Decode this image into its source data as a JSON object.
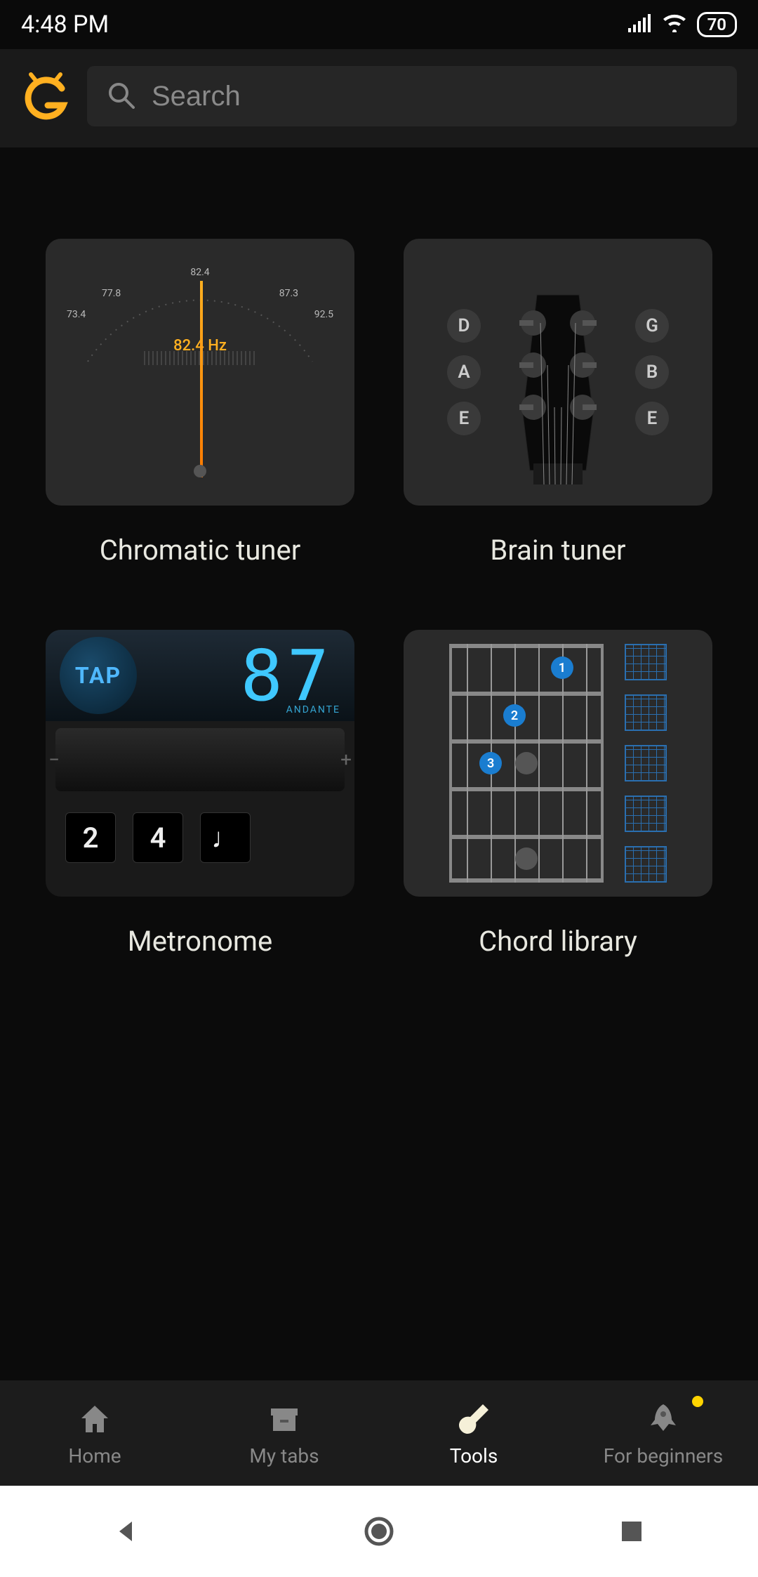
{
  "status": {
    "time": "4:48 PM",
    "battery": "70"
  },
  "search": {
    "placeholder": "Search"
  },
  "tools": {
    "chromatic": {
      "label": "Chromatic tuner",
      "frequency": "82.4 Hz",
      "ticks": {
        "t1": "73.4",
        "t2": "77.8",
        "t3": "82.4",
        "t4": "87.3",
        "t5": "92.5"
      }
    },
    "brain": {
      "label": "Brain tuner",
      "left": [
        "D",
        "A",
        "E"
      ],
      "right": [
        "G",
        "B",
        "E"
      ]
    },
    "metronome": {
      "label": "Metronome",
      "tap": "TAP",
      "bpm": "87",
      "tempo_name": "ANDANTE",
      "btn1": "2",
      "btn2": "4",
      "btn3": "♩"
    },
    "chord": {
      "label": "Chord library",
      "dots": [
        "1",
        "2",
        "3"
      ]
    }
  },
  "nav": {
    "home": "Home",
    "mytabs": "My tabs",
    "tools": "Tools",
    "beginners": "For beginners"
  }
}
